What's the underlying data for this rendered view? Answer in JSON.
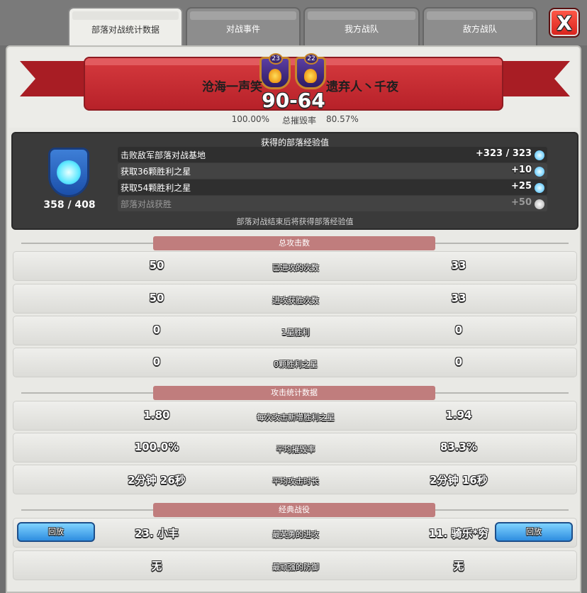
{
  "tabs": [
    "部落对战统计数据",
    "对战事件",
    "我方战队",
    "敌方战队"
  ],
  "close_label": "X",
  "clans": {
    "left": {
      "name": "沧海一声笑",
      "level": "23"
    },
    "right": {
      "name": "遗弃人丶千夜",
      "level": "22"
    },
    "score": "90-64",
    "destruction_left": "100.00%",
    "destruction_label": "总摧毁率",
    "destruction_right": "80.57%"
  },
  "xp": {
    "title": "获得的部落经验值",
    "total": "358 / 408",
    "rows": [
      {
        "label": "击败敌军部落对战基地",
        "value": "+323 / 323"
      },
      {
        "label": "获取36颗胜利之星",
        "value": "+10"
      },
      {
        "label": "获取54颗胜利之星",
        "value": "+25"
      },
      {
        "label": "部落对战获胜",
        "value": "+50"
      }
    ],
    "footer": "部落对战结束后将获得部落经验值"
  },
  "sections": [
    {
      "title": "总攻击数",
      "rows": [
        {
          "left": "50",
          "label": "已进攻的次数",
          "right": "33"
        },
        {
          "left": "50",
          "label": "进攻获胜次数",
          "right": "33"
        },
        {
          "left": "0",
          "label": "1星胜利",
          "right": "0"
        },
        {
          "left": "0",
          "label": "0颗胜利之星",
          "right": "0"
        }
      ]
    },
    {
      "title": "攻击统计数据",
      "rows": [
        {
          "left": "1.80",
          "label": "每次攻击新增胜利之星",
          "right": "1.94"
        },
        {
          "left": "100.0%",
          "label": "平均摧毁率",
          "right": "83.3%"
        },
        {
          "left": "2分钟 26秒",
          "label": "平均攻击时长",
          "right": "2分钟 16秒"
        }
      ]
    },
    {
      "title": "经典战役",
      "rows": [
        {
          "left": "23. 小丰",
          "label": "最英勇的进攻",
          "right": "11. 骑乐*穷"
        },
        {
          "left": "无",
          "label": "最顽强的防御",
          "right": "无"
        }
      ]
    }
  ],
  "replay_label": "回放",
  "colors": {
    "ribbon": "#b72129",
    "section_label": "#c07d7d",
    "xp_box": "#3a3a3a",
    "replay": "#2e8de0",
    "close": "#d8221c"
  }
}
